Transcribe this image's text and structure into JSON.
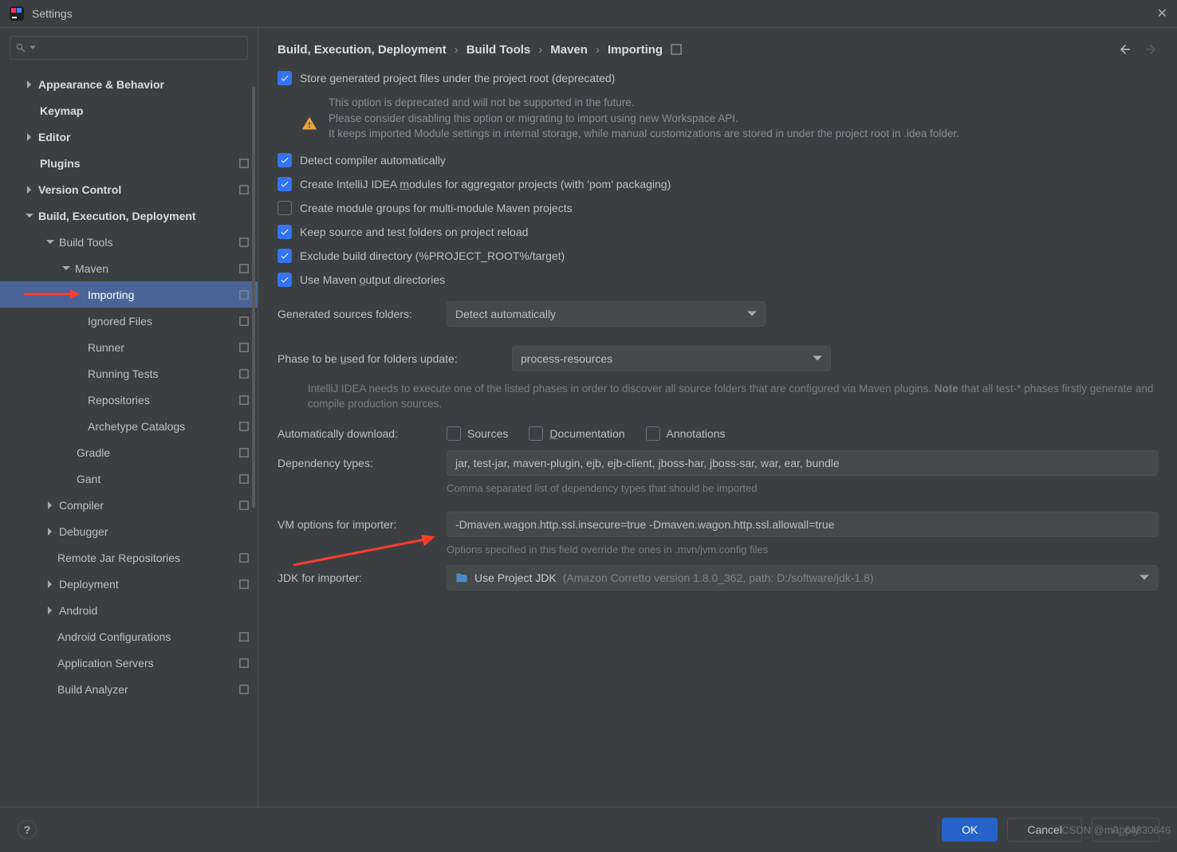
{
  "title": "Settings",
  "search_placeholder": "",
  "tree": {
    "items": [
      {
        "label": "Appearance & Behavior",
        "bold": true,
        "chev": "right",
        "pad": 30
      },
      {
        "label": "Keymap",
        "bold": true,
        "pad": 50
      },
      {
        "label": "Editor",
        "bold": true,
        "chev": "right",
        "pad": 30
      },
      {
        "label": "Plugins",
        "bold": true,
        "pad": 50,
        "dot": true
      },
      {
        "label": "Version Control",
        "bold": true,
        "chev": "right",
        "pad": 30,
        "dot": true
      },
      {
        "label": "Build, Execution, Deployment",
        "bold": true,
        "chev": "down",
        "pad": 30
      },
      {
        "label": "Build Tools",
        "chev": "down",
        "pad": 56,
        "dot": true
      },
      {
        "label": "Maven",
        "chev": "down",
        "pad": 76,
        "dot": true
      },
      {
        "label": "Importing",
        "pad": 110,
        "dot": true,
        "selected": true
      },
      {
        "label": "Ignored Files",
        "pad": 110,
        "dot": true
      },
      {
        "label": "Runner",
        "pad": 110,
        "dot": true
      },
      {
        "label": "Running Tests",
        "pad": 110,
        "dot": true
      },
      {
        "label": "Repositories",
        "pad": 110,
        "dot": true
      },
      {
        "label": "Archetype Catalogs",
        "pad": 110,
        "dot": true
      },
      {
        "label": "Gradle",
        "pad": 96,
        "dot": true
      },
      {
        "label": "Gant",
        "pad": 96,
        "dot": true
      },
      {
        "label": "Compiler",
        "chev": "right",
        "pad": 56,
        "dot": true
      },
      {
        "label": "Debugger",
        "chev": "right",
        "pad": 56
      },
      {
        "label": "Remote Jar Repositories",
        "pad": 72,
        "dot": true
      },
      {
        "label": "Deployment",
        "chev": "right",
        "pad": 56,
        "dot": true
      },
      {
        "label": "Android",
        "chev": "right",
        "pad": 56
      },
      {
        "label": "Android Configurations",
        "pad": 72,
        "dot": true
      },
      {
        "label": "Application Servers",
        "pad": 72,
        "dot": true
      },
      {
        "label": "Build Analyzer",
        "pad": 72,
        "dot": true
      }
    ]
  },
  "crumbs": [
    "Build, Execution, Deployment",
    "Build Tools",
    "Maven",
    "Importing"
  ],
  "opts": {
    "store": "Store generated project files under the project root (deprecated)",
    "warn0": "This option is deprecated and will not be supported in the future.",
    "warn1": "Please consider disabling this option or migrating to import using new Workspace API.",
    "warn2": "It keeps imported Module settings in internal storage, while manual customizations are stored in under the project root in .idea folder.",
    "detect": "Detect compiler automatically",
    "aggr_pre": "Create IntelliJ IDEA ",
    "aggr_u": "m",
    "aggr_post": "odules for aggregator projects (with 'pom' packaging)",
    "groups_pre": "Create module ",
    "groups_u": "g",
    "groups_post": "roups for multi-module Maven projects",
    "keep_pre": "Keep source and test ",
    "keep_u": "f",
    "keep_post": "olders on project reload",
    "exclude": "Exclude build directory (%PROJECT_ROOT%/target)",
    "output_pre": "Use Maven ",
    "output_u": "o",
    "output_post": "utput directories",
    "gensrc_label": "Generated sources folders:",
    "gensrc_val": "Detect automatically",
    "phase_label_pre": "Phase to be ",
    "phase_u": "u",
    "phase_label_post": "sed for folders update:",
    "phase_val": "process-resources",
    "phase_hint_pre": "IntelliJ IDEA needs to execute one of the listed phases in order to discover all source folders that are configured via Maven plugins. ",
    "phase_hint_bold": "Note",
    "phase_hint_post": " that all test-* phases firstly generate and compile production sources.",
    "autodl_label": "Automatically download:",
    "autodl_src": "Sources",
    "autodl_doc_u": "D",
    "autodl_doc": "ocumentation",
    "autodl_ann": "Annotations",
    "dep_label": "Dependency types:",
    "dep_val": "jar, test-jar, maven-plugin, ejb, ejb-client, jboss-har, jboss-sar, war, ear, bundle",
    "dep_hint": "Comma separated list of dependency types that should be imported",
    "vm_label": "VM options for importer:",
    "vm_val": "-Dmaven.wagon.http.ssl.insecure=true -Dmaven.wagon.http.ssl.allowall=true",
    "vm_hint": "Options specified in this field override the ones in .mvn/jvm.config files",
    "jdk_label": "JDK for importer:",
    "jdk_val": "Use Project JDK",
    "jdk_detail": "(Amazon Corretto version 1.8.0_362, path: D:/software/jdk-1.8)"
  },
  "footer": {
    "ok": "OK",
    "cancel": "Cancel",
    "apply": "Apply"
  },
  "watermark": "CSDN @m0_64830646"
}
